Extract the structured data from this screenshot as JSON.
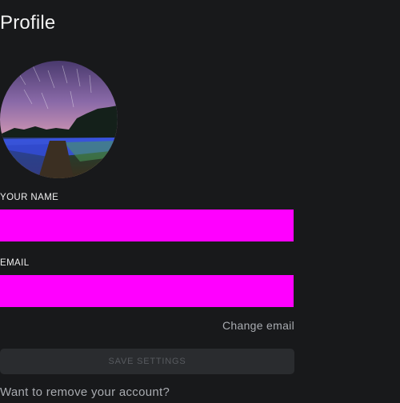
{
  "page": {
    "title": "Profile"
  },
  "avatar": {
    "icon": "profile-photo-night-sky-field"
  },
  "form": {
    "name_label": "YOUR NAME",
    "name_value": "",
    "email_label": "EMAIL",
    "email_value": "",
    "field_color": "#ff00ff",
    "change_email_label": "Change email",
    "save_label": "SAVE SETTINGS",
    "save_disabled": true
  },
  "account": {
    "remove_prompt": "Want to remove your account?"
  },
  "colors": {
    "background": "#18191b",
    "accent_field": "#ff00ff",
    "muted_text": "#a9acb1",
    "disabled_button_bg": "#2a2c2f",
    "disabled_button_text": "#575a5f"
  }
}
